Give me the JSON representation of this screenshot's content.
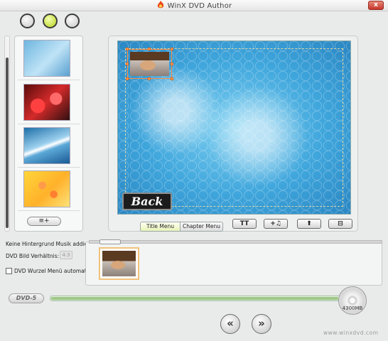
{
  "window": {
    "title": "WinX DVD Author",
    "close_label": "x"
  },
  "toolbar": {
    "circles": [
      "circle-button-1",
      "circle-button-2",
      "circle-button-3"
    ]
  },
  "templates": {
    "items": [
      "blue-mosaic",
      "red-flowers",
      "blue-waves",
      "yellow-flowers"
    ],
    "add_label": "≡+"
  },
  "preview": {
    "back_label": "Back",
    "tabs": {
      "title_menu": "Title Menu",
      "chapter_menu": "Chapter Menu"
    },
    "tools": {
      "text": "TT",
      "music": "+♫",
      "up": "⬆",
      "frame": "⊟"
    }
  },
  "settings": {
    "music_status": "Keine Hintergrund Musik addiert",
    "aspect_label": "DVD Bild Verhältnis:",
    "aspect_value": "4:3",
    "auto_root_menu_label": "DVD Wurzel Menü automatisch addieren",
    "auto_root_menu_checked": false
  },
  "capacity": {
    "dvd_type": "DVD-5",
    "size_label": "4300MB",
    "used_fraction": 0.97
  },
  "nav": {
    "prev": "«",
    "next": "»"
  },
  "footer": {
    "watermark": "www.winxdvd.com"
  },
  "colors": {
    "accent": "#b6d21a",
    "selection": "#ff8a3c"
  }
}
